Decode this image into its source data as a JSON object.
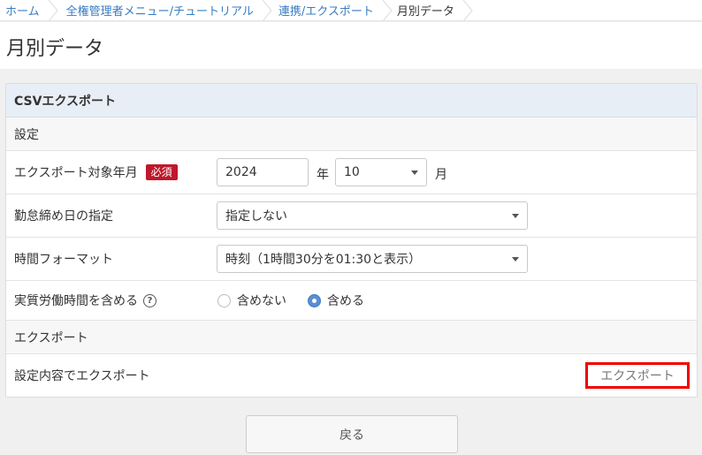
{
  "breadcrumb": {
    "items": [
      "ホーム",
      "全権管理者メニュー/チュートリアル",
      "連携/エクスポート"
    ],
    "current": "月別データ"
  },
  "page": {
    "title": "月別データ"
  },
  "panel": {
    "header": "CSVエクスポート",
    "settings_section": "設定",
    "export_month": {
      "label": "エクスポート対象年月",
      "required_badge": "必須",
      "year_value": "2024",
      "year_unit": "年",
      "month_value": "10",
      "month_unit": "月"
    },
    "closing_day": {
      "label": "勤怠締め日の指定",
      "value": "指定しない"
    },
    "time_format": {
      "label": "時間フォーマット",
      "value": "時刻（1時間30分を01:30と表示）"
    },
    "actual_work": {
      "label": "実質労働時間を含める",
      "help_glyph": "?",
      "options": [
        "含めない",
        "含める"
      ],
      "selected": "含める"
    },
    "export_section": "エクスポート",
    "export_row": {
      "label": "設定内容でエクスポート",
      "button": "エクスポート"
    }
  },
  "footer": {
    "back_button": "戻る"
  },
  "colors": {
    "link": "#3a7cc1",
    "badge": "#c0182b",
    "highlight": "#e00000",
    "header_bg": "#e8eef6"
  }
}
